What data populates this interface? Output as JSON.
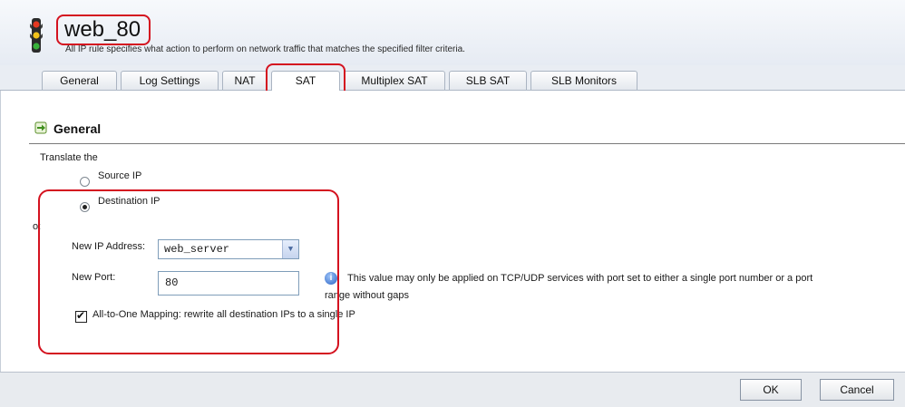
{
  "header": {
    "title": "web_80",
    "subtitle": "All IP rule specifies what action to perform on network traffic that matches the specified filter criteria."
  },
  "tabs": [
    {
      "label": "General"
    },
    {
      "label": "Log Settings"
    },
    {
      "label": "NAT"
    },
    {
      "label": "SAT",
      "active": true
    },
    {
      "label": "Multiplex SAT"
    },
    {
      "label": "SLB SAT"
    },
    {
      "label": "SLB Monitors"
    }
  ],
  "section": {
    "title": "General"
  },
  "form": {
    "translate_label": "Translate the",
    "source_ip_label": "Source IP",
    "destination_ip_label": "Destination IP",
    "selected": "Destination IP",
    "to_label": "o:",
    "new_ip_label": "New IP Address:",
    "new_ip_value": "web_server",
    "new_port_label": "New Port:",
    "new_port_value": "80",
    "info_text_line1": "This value may only be applied on TCP/UDP services with port set to either a single port number or a port",
    "info_text_line2": "range without gaps",
    "mapping_label": "All-to-One Mapping: rewrite all destination IPs to a single IP",
    "mapping_checked": true
  },
  "footer": {
    "ok_label": "OK",
    "cancel_label": "Cancel"
  },
  "colors": {
    "highlight": "#d4121f",
    "info": "#2b63c6"
  }
}
